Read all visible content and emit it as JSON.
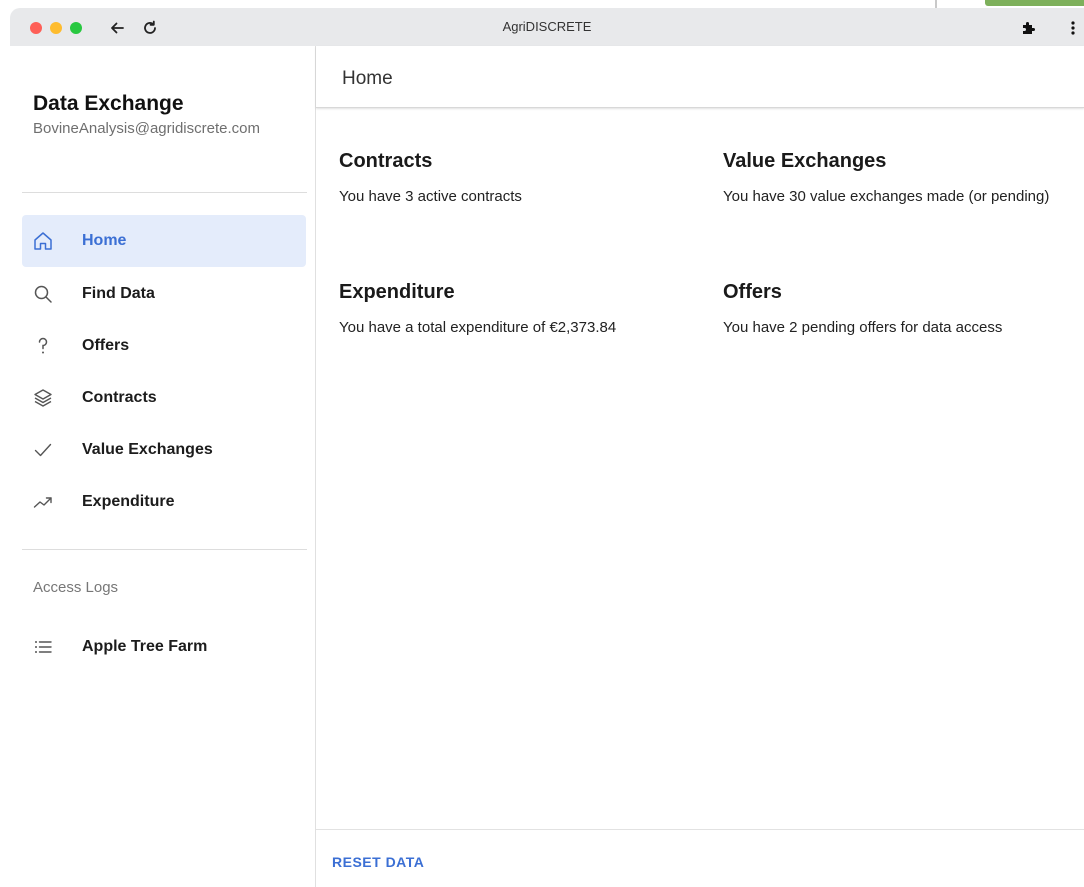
{
  "window": {
    "title": "AgriDISCRETE"
  },
  "sidebar": {
    "title": "Data Exchange",
    "email": "BovineAnalysis@agridiscrete.com",
    "nav_items": [
      {
        "label": "Home",
        "icon": "home-icon",
        "active": true
      },
      {
        "label": "Find Data",
        "icon": "search-icon",
        "active": false
      },
      {
        "label": "Offers",
        "icon": "question-mark-icon",
        "active": false
      },
      {
        "label": "Contracts",
        "icon": "layers-icon",
        "active": false
      },
      {
        "label": "Value Exchanges",
        "icon": "check-icon",
        "active": false
      },
      {
        "label": "Expenditure",
        "icon": "trending-up-icon",
        "active": false
      }
    ],
    "access_logs_label": "Access Logs",
    "access_logs": [
      {
        "label": "Apple Tree Farm",
        "icon": "list-icon"
      }
    ]
  },
  "header": {
    "title": "Home"
  },
  "cards": {
    "contracts": {
      "title": "Contracts",
      "text": "You have 3 active contracts"
    },
    "value_exchanges": {
      "title": "Value Exchanges",
      "text": "You have 30 value exchanges made (or pending)"
    },
    "expenditure": {
      "title": "Expenditure",
      "text": "You have a total expenditure of €2,373.84"
    },
    "offers": {
      "title": "Offers",
      "text": "You have 2 pending offers for data access"
    }
  },
  "footer": {
    "reset_label": "RESET DATA"
  },
  "colors": {
    "accent": "#3b6fd4",
    "active_bg": "#e4ecfb",
    "titlebar": "#e8e9eb"
  }
}
